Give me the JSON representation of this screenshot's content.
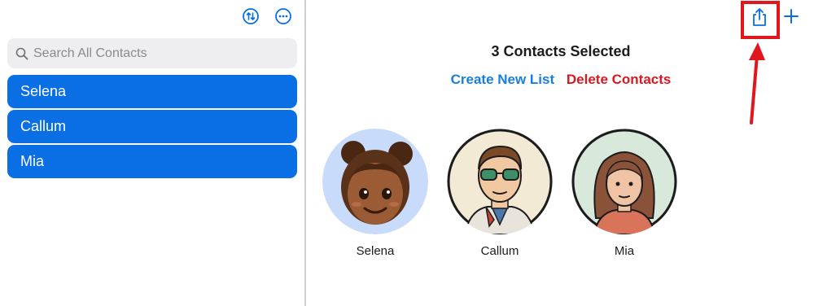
{
  "sidebar": {
    "search": {
      "placeholder": "Search All Contacts"
    },
    "contacts": [
      {
        "name": "Selena"
      },
      {
        "name": "Callum"
      },
      {
        "name": "Mia"
      }
    ]
  },
  "detail": {
    "title": "3 Contacts Selected",
    "actions": {
      "create_list": "Create New List",
      "delete": "Delete Contacts"
    },
    "selected": [
      {
        "name": "Selena"
      },
      {
        "name": "Callum"
      },
      {
        "name": "Mia"
      }
    ]
  },
  "icons": {
    "sort": "sort-arrows-icon",
    "more": "more-icon",
    "search": "search-icon",
    "share": "share-icon",
    "add": "plus-icon"
  },
  "colors": {
    "accent": "#0a6fe5",
    "link": "#1a7fdc",
    "destructive": "#d9191f",
    "annotation": "#e0171d"
  }
}
